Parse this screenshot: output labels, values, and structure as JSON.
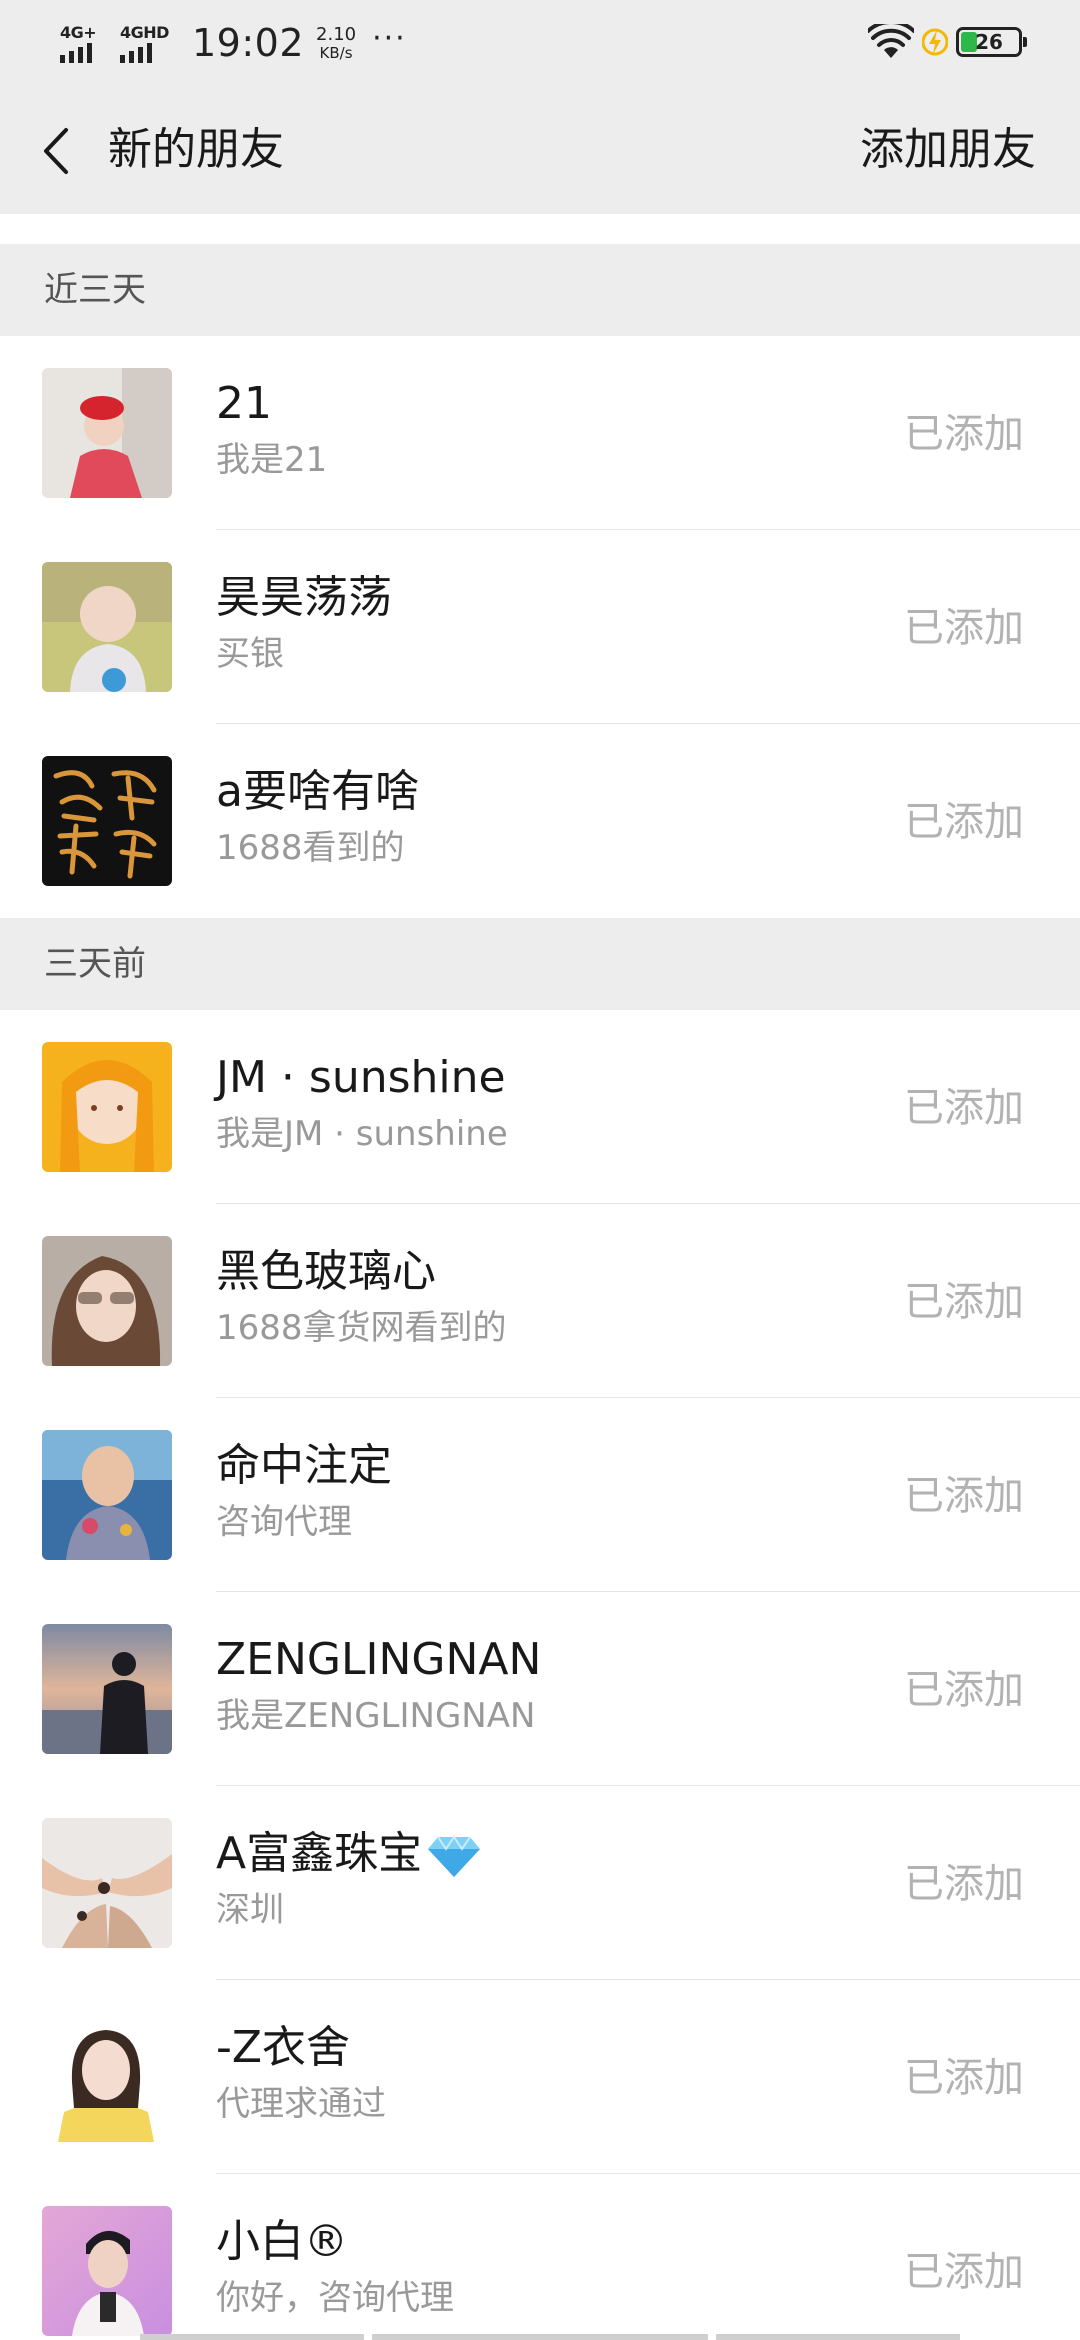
{
  "status_bar": {
    "network1": "4G+",
    "network2": "4GHD",
    "time": "19:02",
    "speed_value": "2.10",
    "speed_unit": "KB/s",
    "more": "···",
    "battery": "26",
    "colors": {
      "battery_fill": "#2fb84a",
      "charging": "#f5b800"
    }
  },
  "nav": {
    "title": "新的朋友",
    "action": "添加朋友"
  },
  "sections": [
    {
      "header": "近三天",
      "items": [
        {
          "name": "21",
          "message": "我是21",
          "status": "已添加"
        },
        {
          "name": "昊昊荡荡",
          "message": "买银",
          "status": "已添加"
        },
        {
          "name": "a要啥有啥",
          "message": "1688看到的",
          "status": "已添加"
        }
      ]
    },
    {
      "header": "三天前",
      "items": [
        {
          "name": "JM · sunshine",
          "message": "我是JM · sunshine",
          "status": "已添加"
        },
        {
          "name": "黑色玻璃心",
          "message": "1688拿货网看到的",
          "status": "已添加"
        },
        {
          "name": "命中注定",
          "message": "咨询代理",
          "status": "已添加"
        },
        {
          "name": "ZENGLINGNAN",
          "message": "我是ZENGLINGNAN",
          "status": "已添加"
        },
        {
          "name": "A富鑫珠宝",
          "message": "深圳",
          "status": "已添加",
          "emoji": "gem-icon"
        },
        {
          "name": "-Z衣舍",
          "message": "代理求通过",
          "status": "已添加"
        },
        {
          "name": "小白®",
          "message": "你好，咨询代理",
          "status": "已添加"
        }
      ]
    }
  ]
}
